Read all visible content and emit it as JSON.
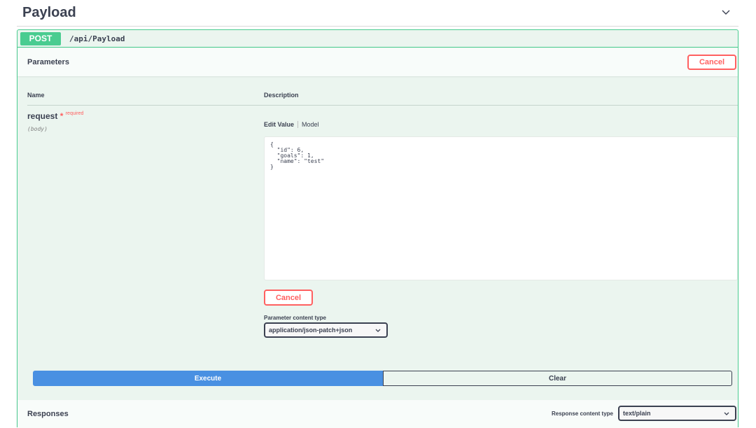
{
  "tag": {
    "title": "Payload",
    "chevron_icon": "chevron-down-icon"
  },
  "operation": {
    "method": "POST",
    "path": "/api/Payload"
  },
  "parameters": {
    "header_label": "Parameters",
    "cancel_label": "Cancel",
    "col_name": "Name",
    "col_description": "Description",
    "param": {
      "name": "request",
      "required_star": "*",
      "required_text": "required",
      "in": "(body)"
    },
    "tabs": {
      "edit_value": "Edit Value",
      "model": "Model"
    },
    "body_value": "{\n  \"id\": 6,\n  \"goals\": 1,\n  \"name\": \"test\"\n}",
    "body_cancel_label": "Cancel",
    "content_type_label": "Parameter content type",
    "content_type_value": "application/json-patch+json"
  },
  "actions": {
    "execute_label": "Execute",
    "clear_label": "Clear"
  },
  "responses": {
    "header_label": "Responses",
    "content_type_label": "Response content type",
    "content_type_value": "text/plain"
  },
  "colors": {
    "post_green": "#49cc90",
    "block_bg": "#ebf5ef",
    "execute_blue": "#4990e2",
    "cancel_red": "#ff6060"
  }
}
